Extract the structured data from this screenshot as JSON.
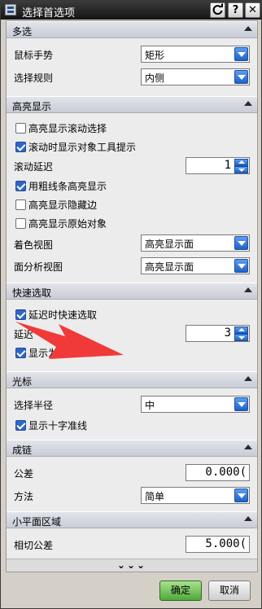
{
  "window": {
    "title": "选择首选项",
    "icons": [
      "refresh-icon",
      "help-icon",
      "close-icon"
    ],
    "help_glyph": "?",
    "close_glyph": "✕"
  },
  "sections": {
    "multi_select": {
      "title": "多选",
      "mouse_gesture_label": "鼠标手势",
      "mouse_gesture_value": "矩形",
      "select_rule_label": "选择规则",
      "select_rule_value": "内侧"
    },
    "highlight": {
      "title": "高亮显示",
      "cb_scroll": {
        "label": "高亮显示滚动选择",
        "checked": false
      },
      "cb_tooltip": {
        "label": "滚动时显示对象工具提示",
        "checked": true
      },
      "scroll_delay_label": "滚动延迟",
      "scroll_delay_value": "1",
      "cb_thick_line": {
        "label": "用粗线条高亮显示",
        "checked": true
      },
      "cb_hidden_edges": {
        "label": "高亮显示隐藏边",
        "checked": false
      },
      "cb_original": {
        "label": "高亮显示原始对象",
        "checked": false
      },
      "shaded_view_label": "着色视图",
      "shaded_view_value": "高亮显示面",
      "face_analysis_label": "面分析视图",
      "face_analysis_value": "高亮显示面"
    },
    "quick_pick": {
      "title": "快速选取",
      "cb_delay_pick": {
        "label": "延迟时快速选取",
        "checked": true
      },
      "delay_label": "延迟",
      "delay_value": "3",
      "cb_show_through": {
        "label": "显示为通透",
        "checked": true
      }
    },
    "cursor": {
      "title": "光标",
      "radius_label": "选择半径",
      "radius_value": "中",
      "cb_crosshair": {
        "label": "显示十字准线",
        "checked": true
      }
    },
    "chaining": {
      "title": "成链",
      "tolerance_label": "公差",
      "tolerance_value": "0.000(",
      "method_label": "方法",
      "method_value": "简单"
    },
    "small_planar": {
      "title": "小平面区域",
      "tangent_tol_label": "相切公差",
      "tangent_tol_value": "5.000("
    }
  },
  "more_indicator": "⌄⌄⌄",
  "buttons": {
    "ok": "确定",
    "cancel": "取消"
  },
  "colors": {
    "accent_blue": "#2f67c8",
    "ok_green": "#4fa83a",
    "arrow_red": "#f03a3a",
    "titlebar": "#1e1e1e"
  }
}
